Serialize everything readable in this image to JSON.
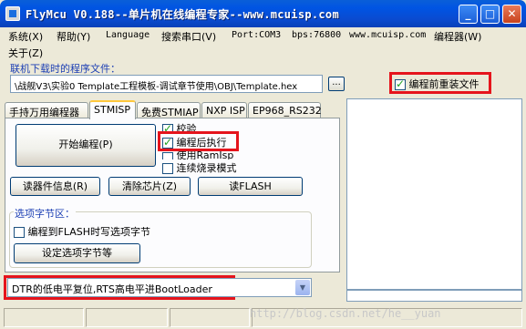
{
  "window": {
    "title": "FlyMcu V0.188--单片机在线编程专家--www.mcuisp.com",
    "minimize": "_",
    "maximize": "□",
    "close": "✕"
  },
  "menu": {
    "system": "系统(X)",
    "help": "帮助(Y)",
    "language": "Language",
    "search_port": "搜索串口(V)",
    "port": "Port:COM3",
    "bps": "bps:76800",
    "site": "www.mcuisp.com",
    "programmer": "编程器(W)",
    "about": "关于(Z)"
  },
  "program_file": {
    "label": "联机下载时的程序文件：",
    "path": "\\战舰V3\\实验0 Template工程模板-调试章节使用\\OBJ\\Template.hex",
    "browse_label": "...",
    "reload_label": "编程前重装文件",
    "reload_checked": true
  },
  "tabs": [
    "手持万用编程器",
    "STMISP",
    "免费STMIAP",
    "NXP ISP",
    "EP968_RS232"
  ],
  "active_tab": "STMISP",
  "stmisp": {
    "start_button": "开始编程(P)",
    "options": [
      {
        "label": "校验",
        "checked": true
      },
      {
        "label": "编程后执行",
        "checked": true
      },
      {
        "label": "使用RamIsp",
        "checked": false
      },
      {
        "label": "连续烧录模式",
        "checked": false
      }
    ],
    "read_info_button": "读器件信息(R)",
    "erase_button": "清除芯片(Z)",
    "read_flash_button": "读FLASH",
    "option_bytes": {
      "group_label": "选项字节区：",
      "write_on_flash_label": "编程到FLASH时写选项字节",
      "write_on_flash_checked": false,
      "set_button": "设定选项字节等"
    }
  },
  "reset_mode": {
    "value": "DTR的低电平复位,RTS高电平进BootLoader"
  },
  "watermark": "http://blog.csdn.net/he__yuan"
}
